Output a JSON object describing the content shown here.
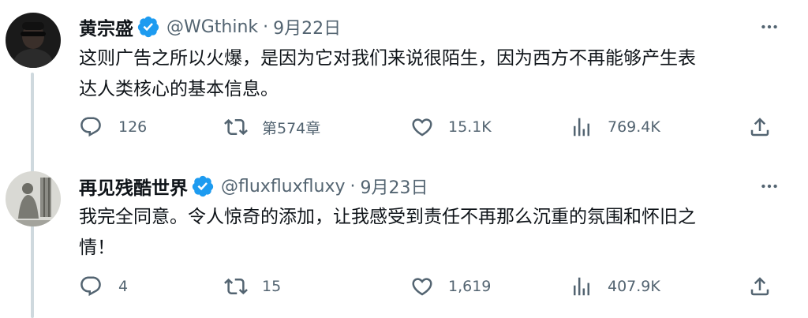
{
  "tweets": [
    {
      "display_name": "黄宗盛",
      "handle": "@WGthink",
      "separator": "·",
      "date": "9月22日",
      "text": "这则广告之所以火爆，是因为它对我们来说很陌生，因为西方不再能够产生表\n达人类核心的基本信息。",
      "replies": "126",
      "retweets": "第574章",
      "likes": "15.1K",
      "views": "769.4K",
      "avatar_icon": "user-avatar-icon"
    },
    {
      "display_name": "再见残酷世界",
      "handle": "@fluxfluxfluxy",
      "separator": "·",
      "date": "9月23日",
      "text": "我完全同意。令人惊奇的添加，让我感受到责任不再那么沉重的氛围和怀旧之\n情！",
      "replies": "4",
      "retweets": "15",
      "likes": "1,619",
      "views": "407.9K",
      "avatar_icon": "user-avatar-icon"
    }
  ],
  "colors": {
    "text_primary": "#0f1419",
    "text_secondary": "#536471",
    "verified_blue": "#1d9bf0",
    "thread_line": "#cfd9de"
  },
  "icons": {
    "verified": "verified-badge-icon",
    "more": "more-options-icon",
    "reply": "reply-icon",
    "retweet": "retweet-icon",
    "like": "like-icon",
    "views": "views-icon",
    "share": "share-icon"
  }
}
